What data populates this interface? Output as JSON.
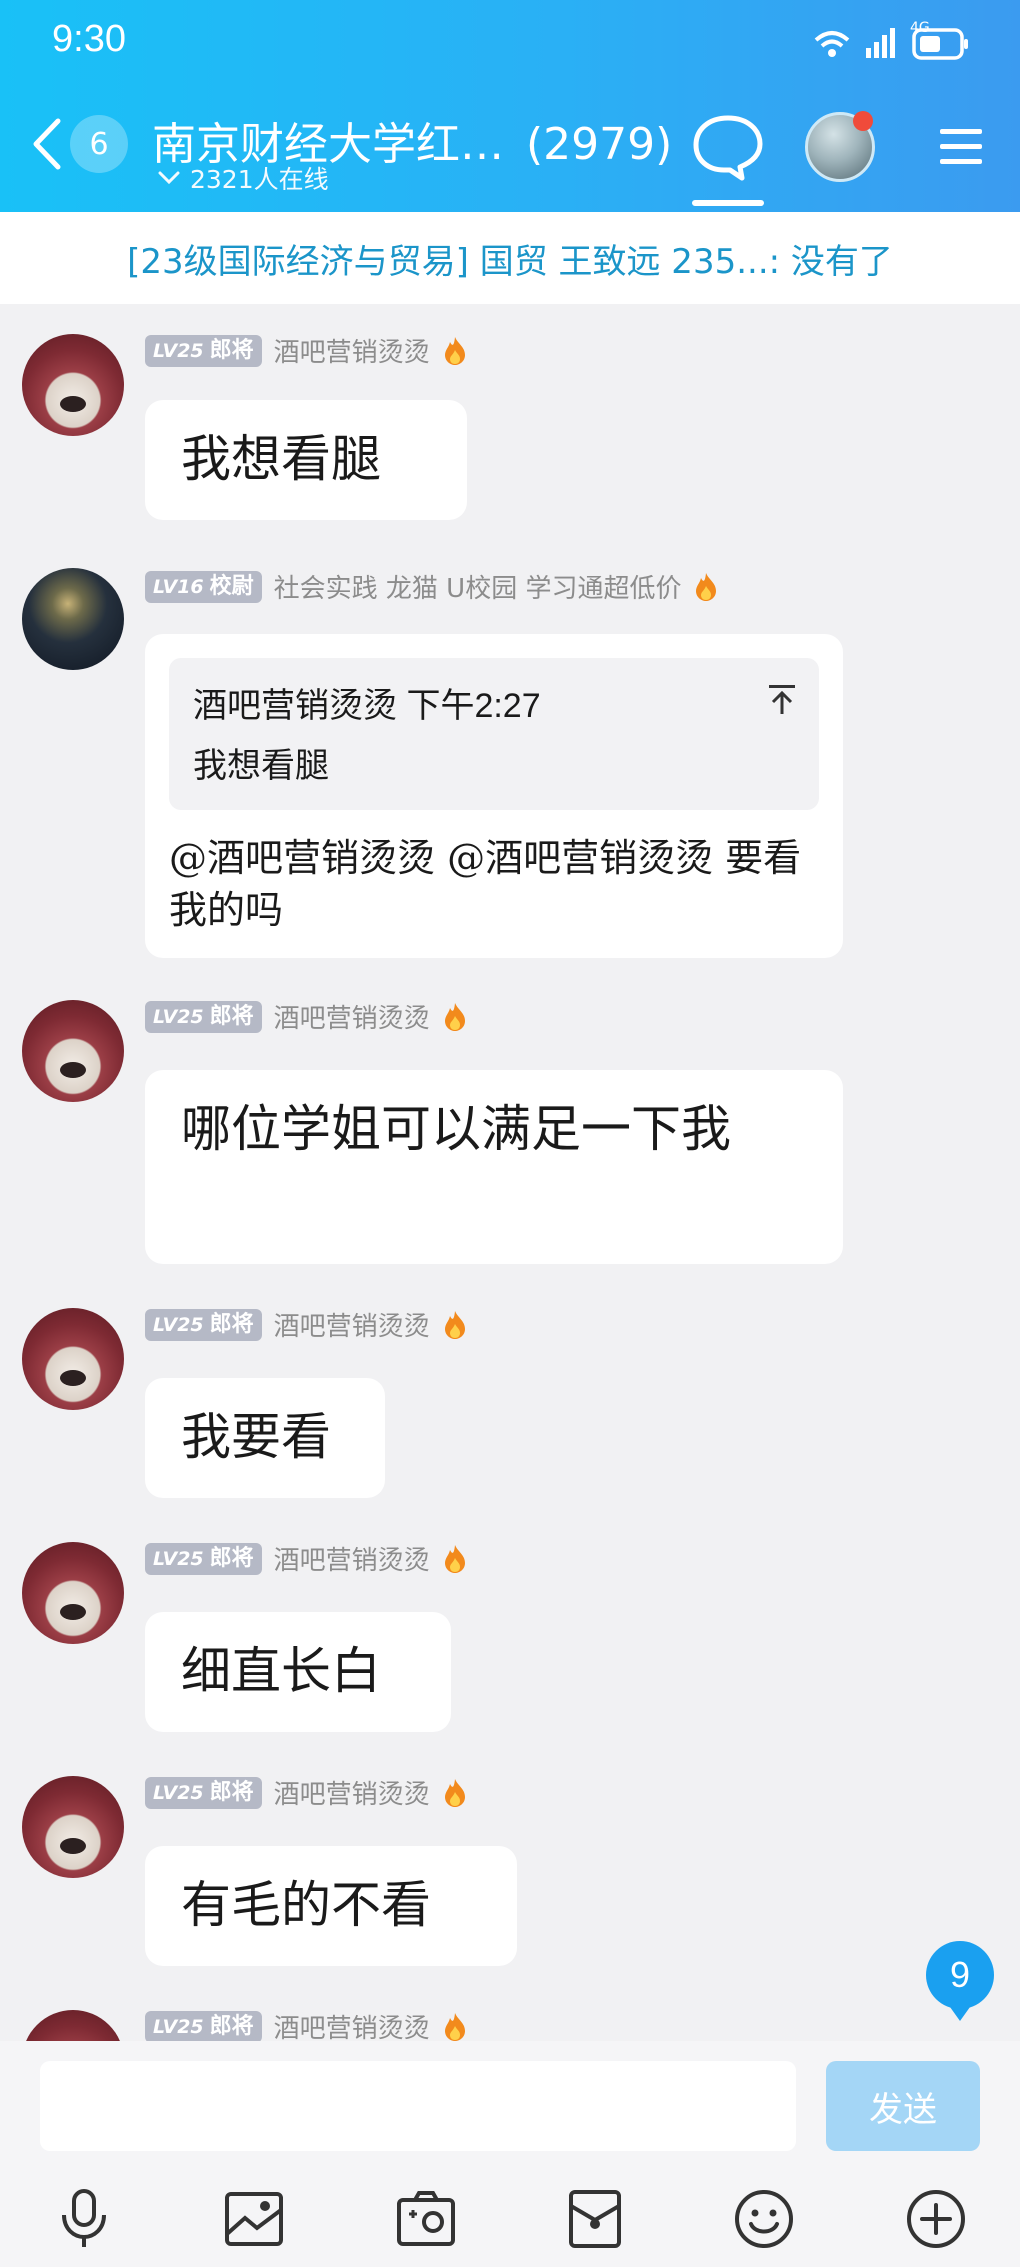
{
  "status_bar": {
    "time": "9:30",
    "network": "4G"
  },
  "header": {
    "back_count": "6",
    "title": "南京财经大学红…",
    "member_count": "(2979)",
    "online": "2321人在线"
  },
  "notice": "[23级国际经济与贸易] 国贸 王致远 235...: 没有了",
  "messages": [
    {
      "level": "LV25",
      "rank": "郎将",
      "name": "酒吧营销烫烫",
      "text": "我想看腿"
    },
    {
      "level": "LV16",
      "rank": "校尉",
      "name": "社会实践 龙猫 U校园 学习通超低价",
      "quote": {
        "sender": "酒吧营销烫烫 下午2:27",
        "text": "我想看腿"
      },
      "text": "@酒吧营销烫烫 @酒吧营销烫烫 要看我的吗"
    },
    {
      "level": "LV25",
      "rank": "郎将",
      "name": "酒吧营销烫烫",
      "text": "哪位学姐可以满足一下我"
    },
    {
      "level": "LV25",
      "rank": "郎将",
      "name": "酒吧营销烫烫",
      "text": "我要看"
    },
    {
      "level": "LV25",
      "rank": "郎将",
      "name": "酒吧营销烫烫",
      "text": "细直长白"
    },
    {
      "level": "LV25",
      "rank": "郎将",
      "name": "酒吧营销烫烫",
      "text": "有毛的不看"
    },
    {
      "level": "LV25",
      "rank": "郎将",
      "name": "酒吧营销烫烫",
      "text": ""
    }
  ],
  "unread_count": "9",
  "input": {
    "placeholder": "",
    "send_label": "发送"
  },
  "toolbar_icons": [
    "microphone-icon",
    "image-icon",
    "camera-icon",
    "red-packet-icon",
    "emoji-icon",
    "plus-icon"
  ],
  "colors": {
    "header_start": "#19c1f7",
    "header_end": "#3b9bf0",
    "notice_text": "#1b95c9",
    "send_button": "#a4d6f6",
    "badge": "#1aa0f0"
  }
}
